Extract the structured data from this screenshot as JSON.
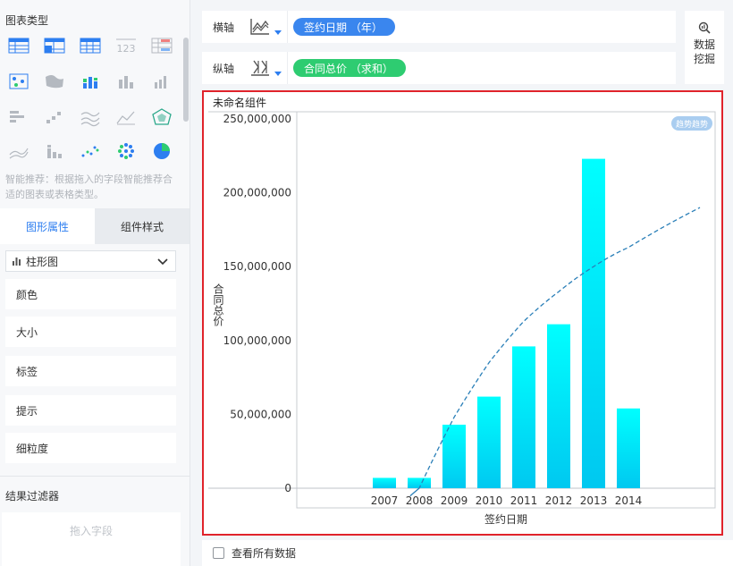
{
  "left_panel": {
    "chart_types_title": "图表类型",
    "chart_type_icons": [
      "cross-table-icon",
      "group-table-icon",
      "detail-table-icon",
      "number-card-icon",
      "kpi-table-icon",
      "dot-map-icon",
      "area-map-icon",
      "stacked-bar-icon",
      "bar-chart-icon",
      "column-chart-icon",
      "horizontal-bar-icon",
      "waterfall-icon",
      "line-chart-icon",
      "area-chart-icon",
      "radar-icon",
      "multi-line-icon",
      "grouped-column-icon",
      "scatter-icon",
      "bubble-icon",
      "pie-icon"
    ],
    "hint": "智能推荐：根据拖入的字段智能推荐合适的图表或表格类型。",
    "tabs": [
      {
        "label": "图形属性",
        "active": true
      },
      {
        "label": "组件样式",
        "active": false
      }
    ],
    "chart_select": "柱形图",
    "properties": [
      "颜色",
      "大小",
      "标签",
      "提示",
      "细粒度"
    ],
    "filter_title": "结果过滤器",
    "filter_placeholder": "拖入字段"
  },
  "axes_config": {
    "x_label": "横轴",
    "x_field": "签约日期 （年）",
    "y_label": "纵轴",
    "y_field": "合同总价 （求和）"
  },
  "mining_button": {
    "line1": "数据",
    "line2": "挖掘"
  },
  "widget": {
    "title": "未命名组件",
    "trend_badge": "趋势趋势"
  },
  "chart_data": {
    "type": "bar",
    "categories": [
      "2007",
      "2008",
      "2009",
      "2010",
      "2011",
      "2012",
      "2013",
      "2014"
    ],
    "series": [
      {
        "values": [
          7000000,
          7000000,
          43000000,
          62000000,
          96000000,
          111000000,
          223000000,
          54000000
        ]
      }
    ],
    "trend_line": {
      "style": "dashed",
      "color": "#2a7fb8",
      "values_at_categories": [
        -20000000,
        0,
        48000000,
        85000000,
        113000000,
        133000000,
        150000000,
        163000000
      ],
      "end_value": 190000000
    },
    "xlabel": "签约日期",
    "ylabel": "合同总价",
    "ylim": [
      0,
      250000000
    ],
    "yticks": [
      "250,000,000",
      "200,000,000",
      "150,000,000",
      "100,000,000",
      "50,000,000",
      "0"
    ],
    "ytick_values": [
      250000000,
      200000000,
      150000000,
      100000000,
      50000000,
      0
    ],
    "bar_color_top": "#00ffff",
    "bar_color_bottom": "#00c8f0",
    "grid": false
  },
  "bottom": {
    "show_all_label": "查看所有数据"
  },
  "colors": {
    "accent": "#2d7ef0",
    "x_pill": "#3a86ee",
    "y_pill": "#2ecc71",
    "highlight_border": "#e0232b"
  }
}
